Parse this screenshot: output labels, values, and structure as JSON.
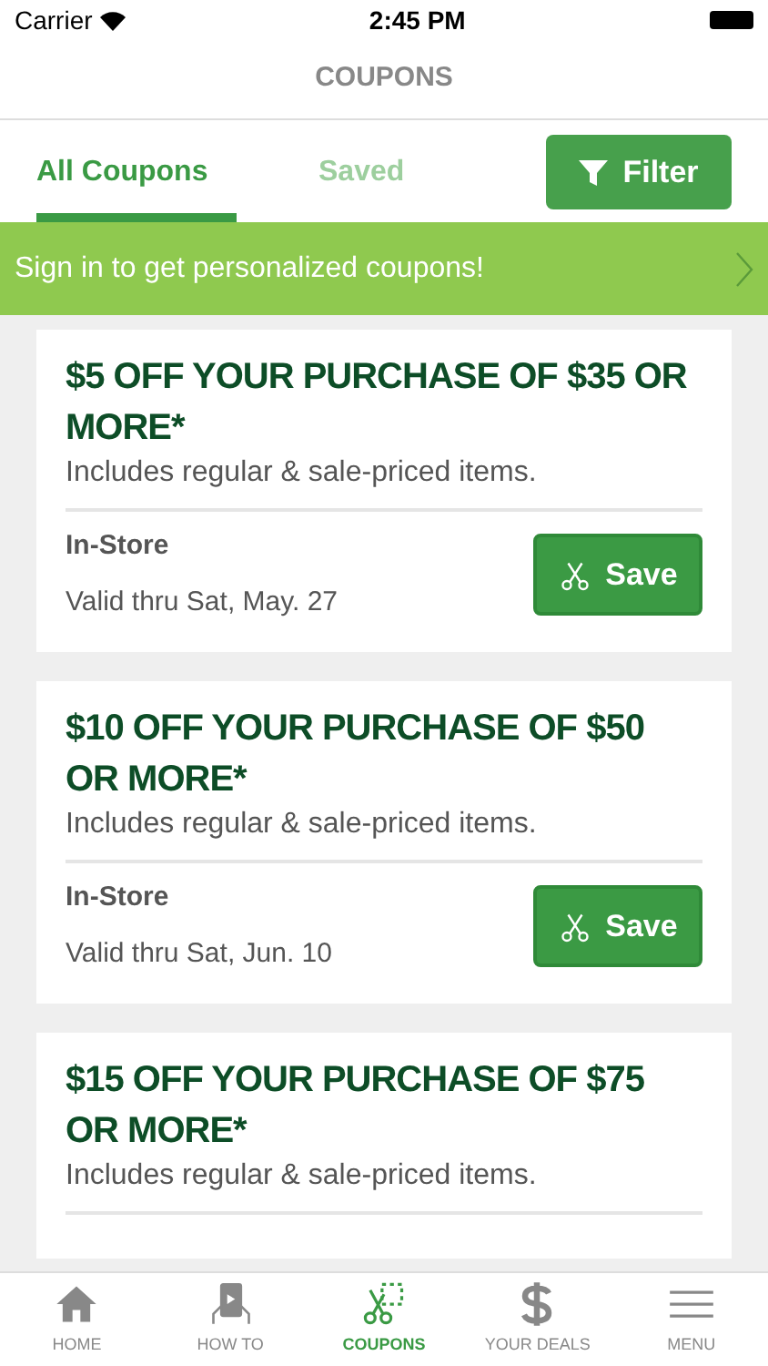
{
  "status_bar": {
    "carrier": "Carrier",
    "time": "2:45 PM"
  },
  "header": {
    "title": "COUPONS"
  },
  "tabs": [
    {
      "label": "All Coupons",
      "selected": true
    },
    {
      "label": "Saved",
      "selected": false
    }
  ],
  "filter_button": {
    "label": "Filter"
  },
  "banner": {
    "text": "Sign in to get personalized coupons!"
  },
  "coupons": [
    {
      "title": "$5 OFF YOUR PURCHASE OF $35 OR MORE*",
      "description": "Includes regular & sale-priced items.",
      "channel": "In-Store",
      "valid": "Valid thru Sat, May. 27",
      "button": "Save"
    },
    {
      "title": "$10 OFF YOUR PURCHASE OF $50 OR MORE*",
      "description": "Includes regular & sale-priced items.",
      "channel": "In-Store",
      "valid": "Valid thru Sat, Jun. 10",
      "button": "Save"
    },
    {
      "title": "$15 OFF YOUR PURCHASE OF $75 OR MORE*",
      "description": "Includes regular & sale-priced items."
    }
  ],
  "tab_bar": [
    {
      "label": "HOME",
      "kind": "home",
      "selected": false
    },
    {
      "label": "HOW TO",
      "kind": "howto",
      "selected": false
    },
    {
      "label": "COUPONS",
      "kind": "coupons",
      "selected": true
    },
    {
      "label": "YOUR DEALS",
      "kind": "deals",
      "selected": false
    },
    {
      "label": "MENU",
      "kind": "menu",
      "selected": false
    }
  ]
}
